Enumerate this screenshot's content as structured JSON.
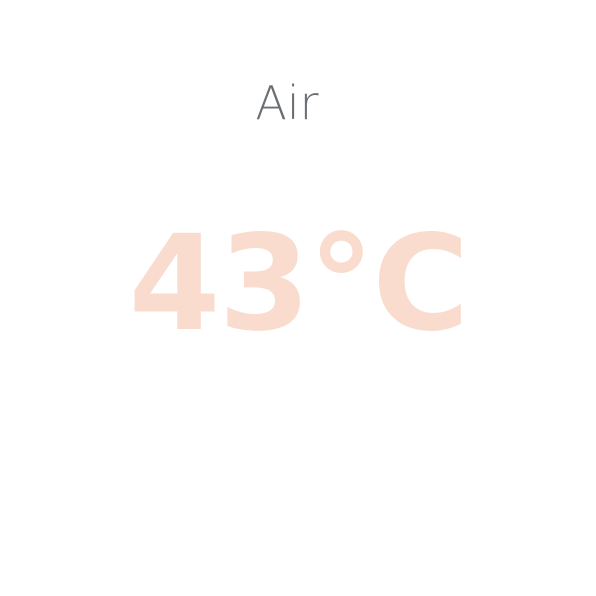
{
  "widget": {
    "label": "Air",
    "value": "43°C"
  },
  "colors": {
    "background": "#ffffff",
    "label": "#6b6f73",
    "value": "#f9dccd"
  }
}
